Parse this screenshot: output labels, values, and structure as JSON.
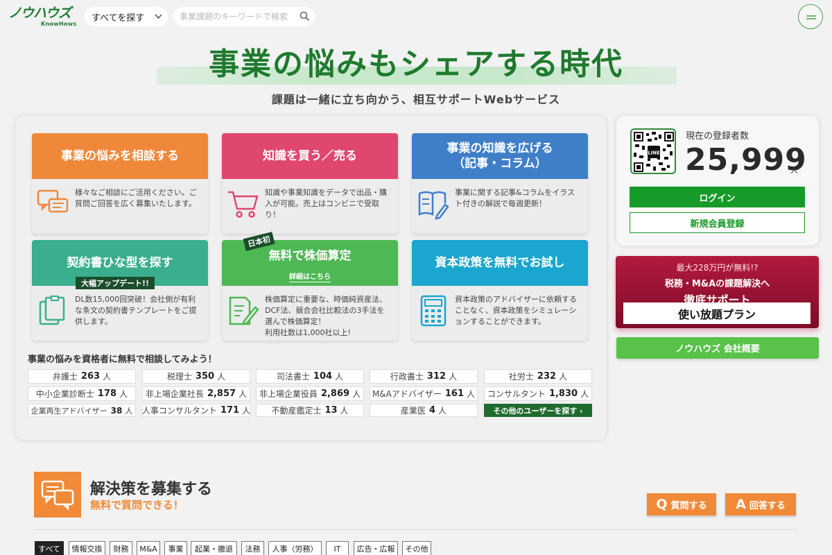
{
  "header": {
    "logo_main": "ノウハウズ",
    "logo_sub": "KnowHows",
    "category_select": "すべてを探す",
    "search_placeholder": "事業課題のキーワードで検索"
  },
  "hero": {
    "title": "事業の悩みもシェアする時代",
    "subtitle": "課題は一緒に立ち向かう、相互サポートWebサービス"
  },
  "services": [
    {
      "title": "事業の悩みを相談する",
      "text": "様々なご相談にご活用ください。ご質問ご回答を広く募集いたします。",
      "color": "#f0883a"
    },
    {
      "title": "知識を買う／売る",
      "text": "知識や事業知識をデータで出品・購入が可能。売上はコンビニで受取り！",
      "color": "#e0476e"
    },
    {
      "title": "事業の知識を広げる\n（記事・コラム）",
      "text": "事業に関する記事&コラムをイラスト付きの解説で毎週更新！",
      "color": "#3e7fc8"
    },
    {
      "title": "契約書ひな型を探す",
      "badge": "大幅アップデート!!",
      "text": "DL数15,000回突破！会社側が有利な条文の契約書テンプレートをご提供します。",
      "color": "#3aae8e"
    },
    {
      "title": "無料で株価算定",
      "badge": "日本初",
      "link": "詳細はこちら",
      "text": "株価算定に重要な、時価純資産法、DCF法、競合会社比較法の3手法を選んで株価算定！\n利用社数は1,000社以上!",
      "color": "#4db854"
    },
    {
      "title": "資本政策を無料でお試し",
      "text": "資本政策のアドバイザーに依頼することなく、資本政策をシミュレーションすることができます。",
      "color": "#1aa6cf"
    }
  ],
  "experts": {
    "heading": "事業の悩みを資格者に無料で相談してみよう！",
    "unit": "人",
    "items": [
      {
        "label": "弁護士",
        "count": "263"
      },
      {
        "label": "税理士",
        "count": "350"
      },
      {
        "label": "司法書士",
        "count": "104"
      },
      {
        "label": "行政書士",
        "count": "312"
      },
      {
        "label": "社労士",
        "count": "232"
      },
      {
        "label": "中小企業診断士",
        "count": "178"
      },
      {
        "label": "非上場企業社長",
        "count": "2,857"
      },
      {
        "label": "非上場企業役員",
        "count": "2,869"
      },
      {
        "label": "M&Aアドバイザー",
        "count": "161"
      },
      {
        "label": "コンサルタント",
        "count": "1,830"
      },
      {
        "label": "企業再生アドバイザー",
        "count": "38"
      },
      {
        "label": "人事コンサルタント",
        "count": "171"
      },
      {
        "label": "不動産鑑定士",
        "count": "13"
      },
      {
        "label": "産業医",
        "count": "4"
      }
    ],
    "more_label": "その他のユーザーを探す ›"
  },
  "registration": {
    "label": "現在の登録者数",
    "count": "25,999",
    "unit": "人",
    "qr_label": "LINE",
    "login": "ログイン",
    "signup": "新規会員登録"
  },
  "promo": {
    "line1": "最大228万円が無料!?",
    "line2": "税務・M&Aの課題解決へ",
    "line3": "徹底サポート",
    "cta": "使い放題プラン"
  },
  "company_button": "ノウハウズ 会社概要",
  "solutions": {
    "title": "解決策を募集する",
    "subtitle": "無料で質問できる！",
    "ask_letter": "Q",
    "ask": "質問する",
    "answer_letter": "A",
    "answer": "回答する"
  },
  "tags": [
    "すべて",
    "情報交換",
    "財務",
    "M&A",
    "事業",
    "起業・撤退",
    "法務",
    "人事（労務）",
    "IT",
    "広告・広報",
    "その他"
  ]
}
